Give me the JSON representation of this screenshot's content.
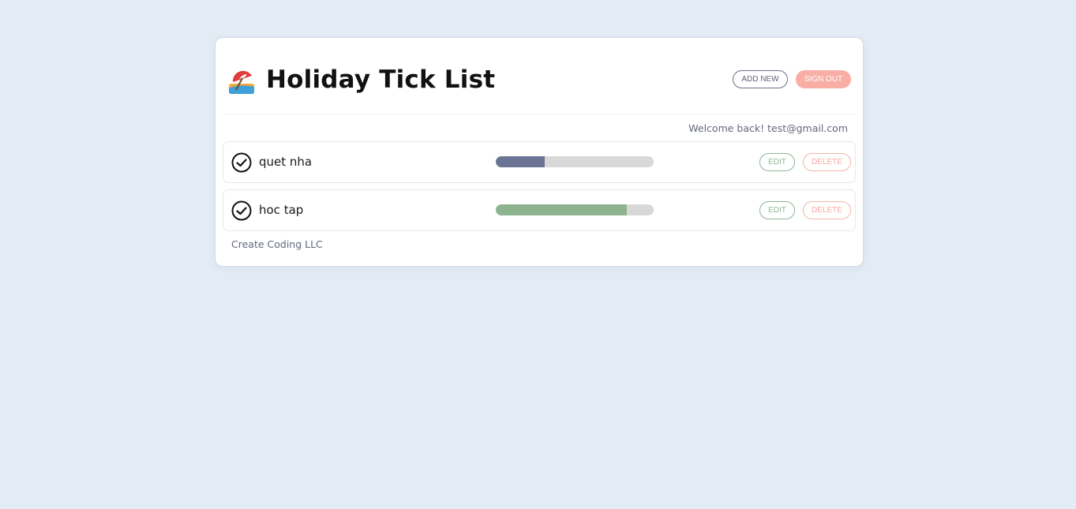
{
  "header": {
    "logo_icon": "beach-umbrella-icon",
    "title": "Holiday Tick List",
    "add_new_label": "ADD NEW",
    "sign_out_label": "SIGN OUT"
  },
  "welcome_text": "Welcome back! test@gmail.com",
  "tasks": [
    {
      "label": "quet nha",
      "progress": 0.31,
      "progress_color": "#6b7495",
      "edit_label": "EDIT",
      "delete_label": "DELETE"
    },
    {
      "label": "hoc tap",
      "progress": 0.83,
      "progress_color": "#8db38f",
      "edit_label": "EDIT",
      "delete_label": "DELETE"
    }
  ],
  "footer_text": "Create Coding LLC",
  "colors": {
    "background": "#e3ecf5",
    "sign_out": "#f8aea5",
    "edit": "#8fb796",
    "delete": "#f7a89e"
  }
}
